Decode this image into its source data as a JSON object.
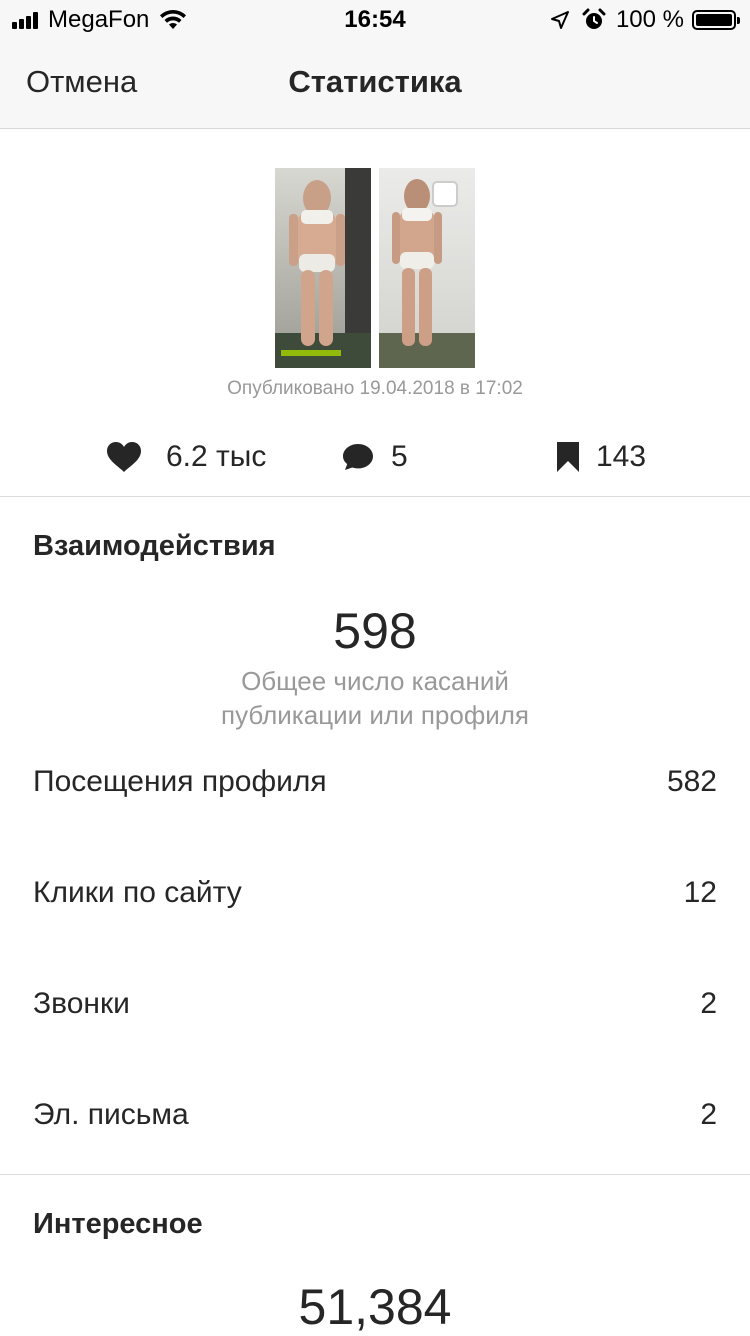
{
  "status_bar": {
    "carrier": "MegaFon",
    "time": "16:54",
    "battery": "100 %"
  },
  "nav": {
    "cancel_label": "Отмена",
    "title": "Статистика"
  },
  "post": {
    "published": "Опубликовано 19.04.2018 в 17:02",
    "likes": "6.2 тыс",
    "comments": "5",
    "saves": "143"
  },
  "interactions": {
    "title": "Взаимодействия",
    "total": "598",
    "subtitle_line1": "Общее число касаний",
    "subtitle_line2": "публикации или профиля",
    "metrics": [
      {
        "label": "Посещения профиля",
        "value": "582"
      },
      {
        "label": "Клики по сайту",
        "value": "12"
      },
      {
        "label": "Звонки",
        "value": "2"
      },
      {
        "label": "Эл. письма",
        "value": "2"
      }
    ]
  },
  "discovery": {
    "title": "Интересное",
    "total": "51,384"
  },
  "icons": {
    "likes": "heart-icon",
    "comments": "comment-icon",
    "saves": "bookmark-icon"
  }
}
